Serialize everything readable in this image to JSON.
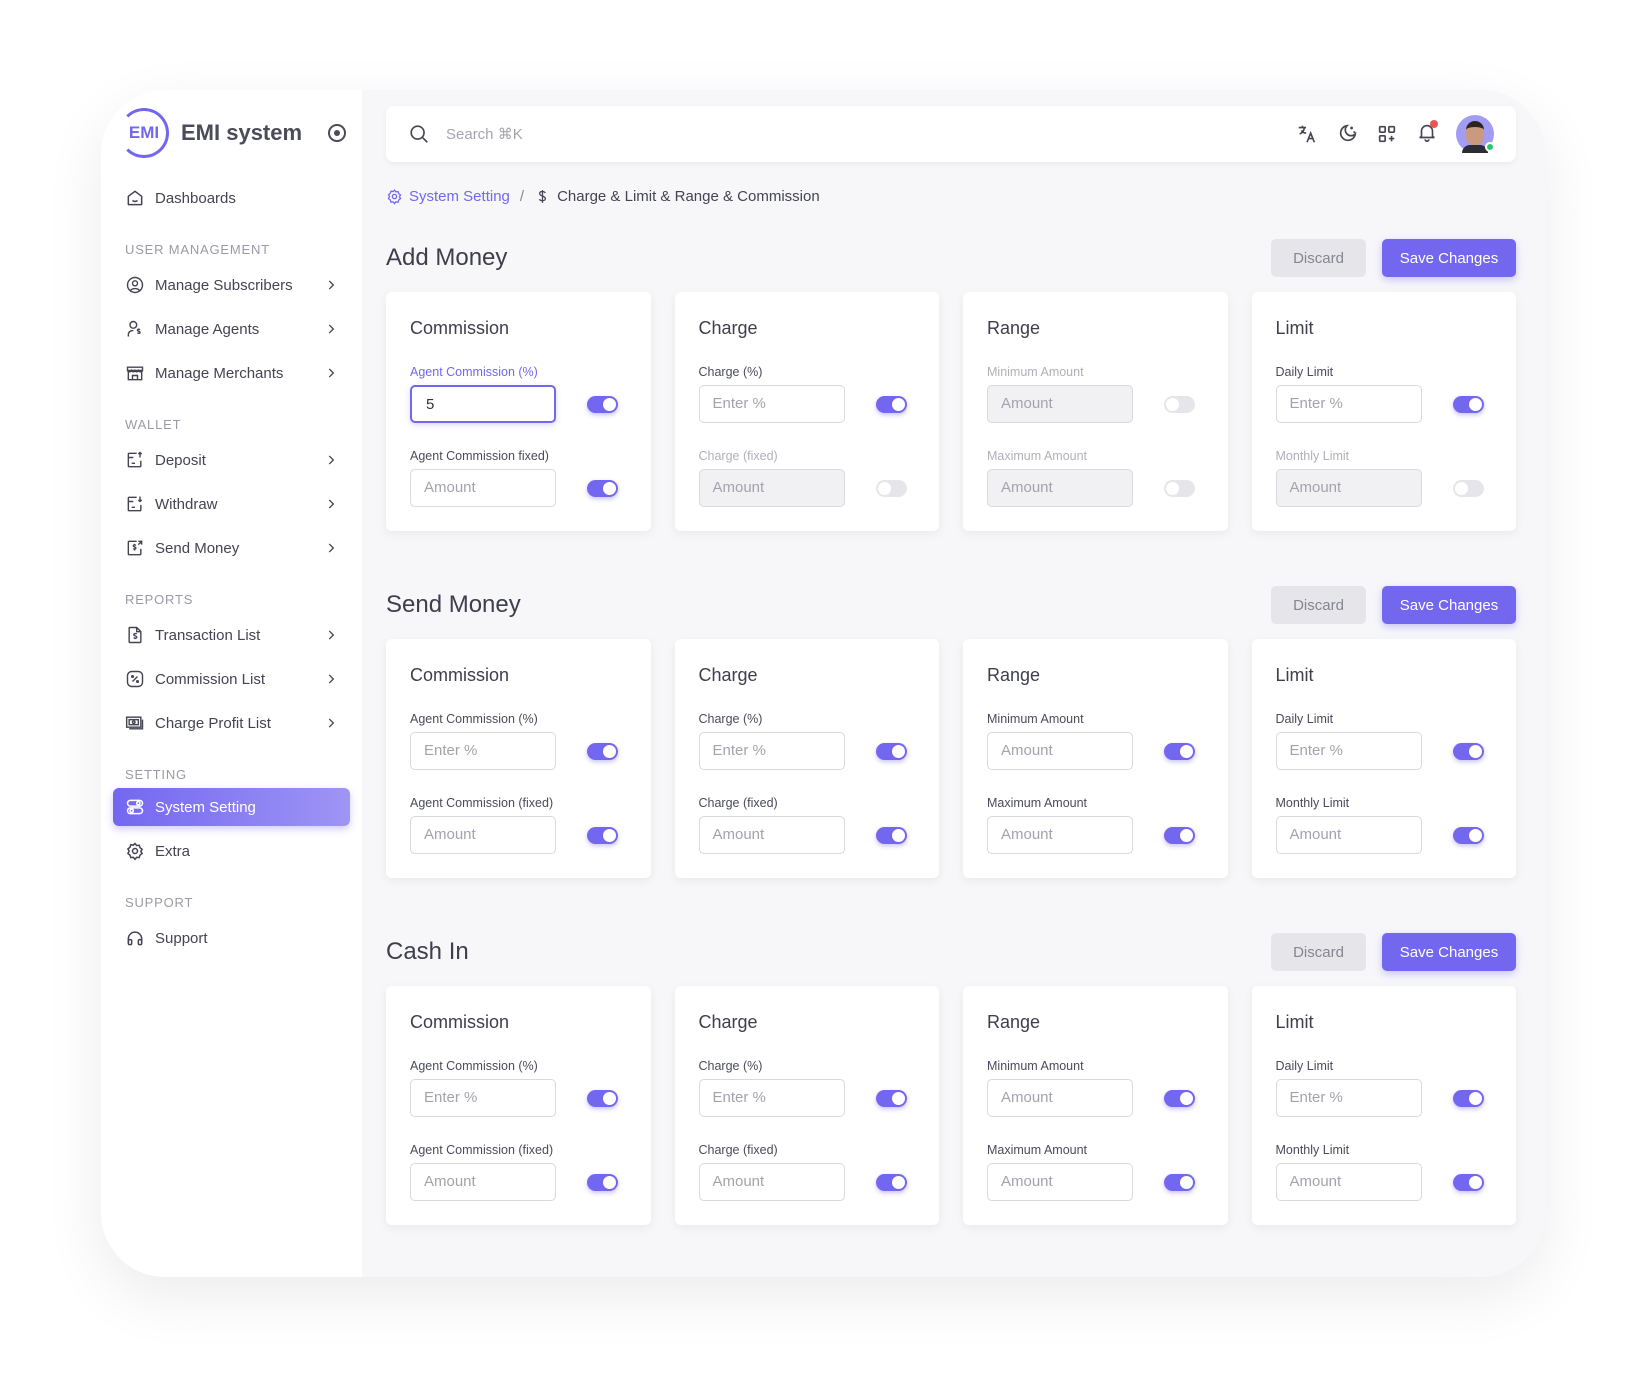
{
  "brand": {
    "logo_text": "EMI",
    "name": "EMI system"
  },
  "sidebar": {
    "dashboards": "Dashboards",
    "groups": [
      {
        "heading": "User Management",
        "items": [
          {
            "label": "Manage Subscribers",
            "icon": "user-circle-icon"
          },
          {
            "label": "Manage Agents",
            "icon": "user-dollar-icon"
          },
          {
            "label": "Manage Merchants",
            "icon": "store-icon"
          }
        ]
      },
      {
        "heading": "Wallet",
        "items": [
          {
            "label": "Deposit",
            "icon": "deposit-icon"
          },
          {
            "label": "Withdraw",
            "icon": "withdraw-icon"
          },
          {
            "label": "Send Money",
            "icon": "send-money-icon"
          }
        ]
      },
      {
        "heading": "Reports",
        "items": [
          {
            "label": "Transaction List",
            "icon": "receipt-icon"
          },
          {
            "label": "Commission List",
            "icon": "percent-icon"
          },
          {
            "label": "Charge Profit List",
            "icon": "cash-icon"
          }
        ]
      }
    ],
    "setting_heading": "Setting",
    "system_setting": "System Setting",
    "extra": "Extra",
    "support_heading": "Support",
    "support": "Support"
  },
  "topbar": {
    "search_placeholder": "Search ⌘K",
    "icons": [
      "translate-icon",
      "moon-icon",
      "apps-icon",
      "bell-icon"
    ],
    "has_notification": true,
    "user_online": true
  },
  "breadcrumb": {
    "parent": "System Setting",
    "current": "Charge & Limit & Range & Commission"
  },
  "colors": {
    "accent": "#7367f0",
    "online": "#28c76f",
    "notification": "#ea5455"
  },
  "sections": [
    {
      "title": "Add Money",
      "discard": "Discard",
      "save": "Save Changes",
      "cards": [
        {
          "title": "Commission",
          "fields": [
            {
              "label": "Agent Commission (%)",
              "placeholder": "Enter %",
              "value": "5",
              "enabled": true,
              "focused": true
            },
            {
              "label": "Agent Commission fixed)",
              "placeholder": "Amount",
              "value": "",
              "enabled": true
            }
          ]
        },
        {
          "title": "Charge",
          "fields": [
            {
              "label": "Charge (%)",
              "placeholder": "Enter %",
              "value": "",
              "enabled": true
            },
            {
              "label": "Charge (fixed)",
              "placeholder": "Amount",
              "value": "",
              "enabled": false
            }
          ]
        },
        {
          "title": "Range",
          "fields": [
            {
              "label": "Minimum Amount",
              "placeholder": "Amount",
              "value": "",
              "enabled": false
            },
            {
              "label": "Maximum Amount",
              "placeholder": "Amount",
              "value": "",
              "enabled": false
            }
          ]
        },
        {
          "title": "Limit",
          "fields": [
            {
              "label": "Daily Limit",
              "placeholder": "Enter %",
              "value": "",
              "enabled": true
            },
            {
              "label": "Monthly Limit",
              "placeholder": "Amount",
              "value": "",
              "enabled": false
            }
          ]
        }
      ]
    },
    {
      "title": "Send Money",
      "discard": "Discard",
      "save": "Save Changes",
      "cards": [
        {
          "title": "Commission",
          "fields": [
            {
              "label": "Agent Commission (%)",
              "placeholder": "Enter %",
              "value": "",
              "enabled": true
            },
            {
              "label": "Agent Commission (fixed)",
              "placeholder": "Amount",
              "value": "",
              "enabled": true
            }
          ]
        },
        {
          "title": "Charge",
          "fields": [
            {
              "label": "Charge (%)",
              "placeholder": "Enter %",
              "value": "",
              "enabled": true
            },
            {
              "label": "Charge (fixed)",
              "placeholder": "Amount",
              "value": "",
              "enabled": true
            }
          ]
        },
        {
          "title": "Range",
          "fields": [
            {
              "label": "Minimum Amount",
              "placeholder": "Amount",
              "value": "",
              "enabled": true
            },
            {
              "label": "Maximum Amount",
              "placeholder": "Amount",
              "value": "",
              "enabled": true
            }
          ]
        },
        {
          "title": "Limit",
          "fields": [
            {
              "label": "Daily Limit",
              "placeholder": "Enter %",
              "value": "",
              "enabled": true
            },
            {
              "label": "Monthly Limit",
              "placeholder": "Amount",
              "value": "",
              "enabled": true
            }
          ]
        }
      ]
    },
    {
      "title": "Cash In",
      "discard": "Discard",
      "save": "Save Changes",
      "cards": [
        {
          "title": "Commission",
          "fields": [
            {
              "label": "Agent Commission (%)",
              "placeholder": "Enter %",
              "value": "",
              "enabled": true
            },
            {
              "label": "Agent Commission (fixed)",
              "placeholder": "Amount",
              "value": "",
              "enabled": true
            }
          ]
        },
        {
          "title": "Charge",
          "fields": [
            {
              "label": "Charge (%)",
              "placeholder": "Enter %",
              "value": "",
              "enabled": true
            },
            {
              "label": "Charge (fixed)",
              "placeholder": "Amount",
              "value": "",
              "enabled": true
            }
          ]
        },
        {
          "title": "Range",
          "fields": [
            {
              "label": "Minimum Amount",
              "placeholder": "Amount",
              "value": "",
              "enabled": true
            },
            {
              "label": "Maximum Amount",
              "placeholder": "Amount",
              "value": "",
              "enabled": true
            }
          ]
        },
        {
          "title": "Limit",
          "fields": [
            {
              "label": "Daily Limit",
              "placeholder": "Enter %",
              "value": "",
              "enabled": true
            },
            {
              "label": "Monthly Limit",
              "placeholder": "Amount",
              "value": "",
              "enabled": true
            }
          ]
        }
      ]
    }
  ]
}
